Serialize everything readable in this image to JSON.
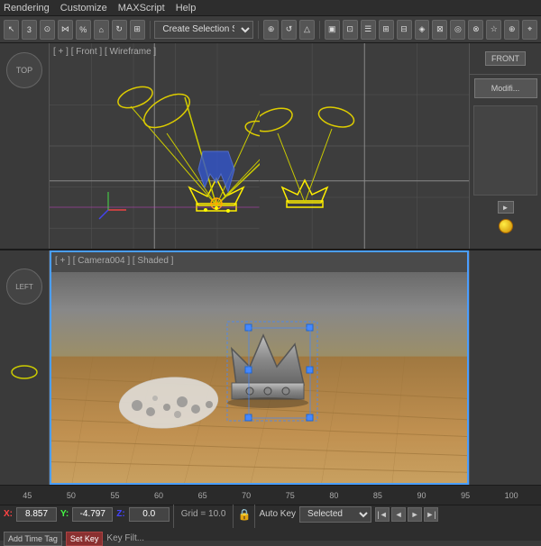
{
  "menubar": {
    "items": [
      "Rendering",
      "Customize",
      "MAXScript",
      "Help"
    ]
  },
  "toolbar": {
    "dropdown_label": "Create Selection S...",
    "buttons": [
      "arrow",
      "rotate",
      "scale",
      "move",
      "select"
    ]
  },
  "viewport_front": {
    "label": "[ + ] [ Front ] [ Wireframe ]"
  },
  "viewport_camera": {
    "label": "[ + ] [ Camera004 ] [ Shaded ]"
  },
  "viewport_top": {
    "label": "TOP"
  },
  "right_panel": {
    "front_label": "FRONT",
    "modifi_label": "Modifi..."
  },
  "statusbar": {
    "x_label": "X:",
    "x_value": "8.857",
    "y_label": "Y:",
    "y_value": "-4.797",
    "z_label": "Z:",
    "z_value": "0.0",
    "grid_label": "Grid = 10.0",
    "autokey_label": "Auto Key",
    "selected_label": "Selected",
    "set_key_label": "Set Key",
    "add_time_label": "Add Time Tag",
    "key_filt_label": "Key Filt..."
  },
  "timeline": {
    "ticks": [
      "45",
      "50",
      "55",
      "60",
      "65",
      "70",
      "75",
      "80",
      "85",
      "90",
      "95",
      "100"
    ]
  }
}
